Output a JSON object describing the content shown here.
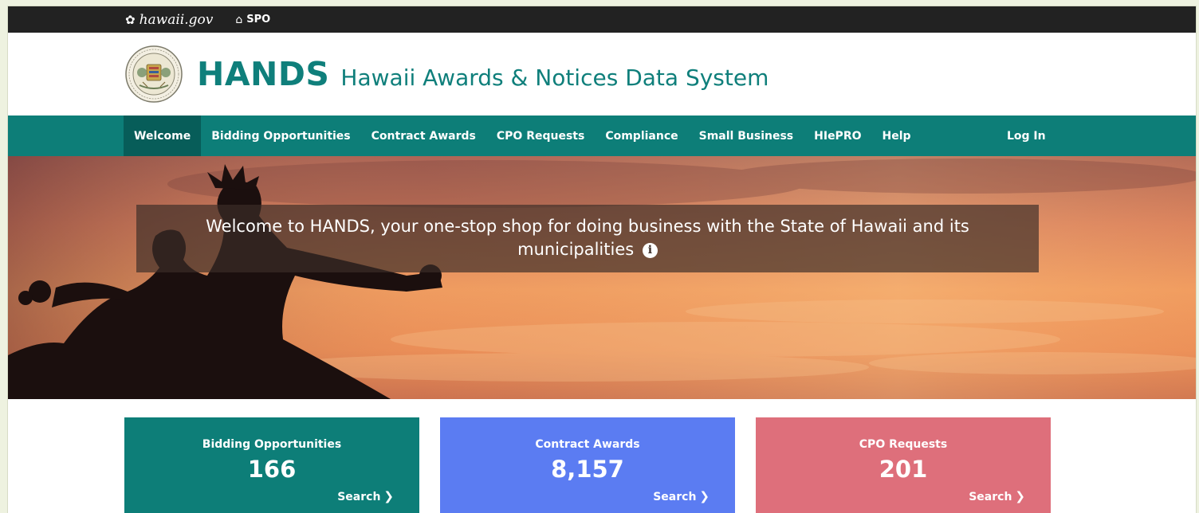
{
  "utility": {
    "gov_label": "hawaii.gov",
    "spo_label": "SPO"
  },
  "header": {
    "title": "HANDS",
    "subtitle": "Hawaii Awards & Notices Data System"
  },
  "nav": {
    "items": [
      {
        "label": "Welcome"
      },
      {
        "label": "Bidding Opportunities"
      },
      {
        "label": "Contract Awards"
      },
      {
        "label": "CPO Requests"
      },
      {
        "label": "Compliance"
      },
      {
        "label": "Small Business"
      },
      {
        "label": "HIePRO"
      },
      {
        "label": "Help"
      }
    ],
    "login": "Log In"
  },
  "hero": {
    "welcome_line1": "Welcome to HANDS, your one-stop shop for doing business with the State of Hawaii and its",
    "welcome_line2": "municipalities"
  },
  "cards": [
    {
      "title": "Bidding Opportunities",
      "count": "166",
      "action": "Search",
      "color": "#0d7e78"
    },
    {
      "title": "Contract Awards",
      "count": "8,157",
      "action": "Search",
      "color": "#5b7cf2"
    },
    {
      "title": "CPO Requests",
      "count": "201",
      "action": "Search",
      "color": "#de6f7b"
    }
  ],
  "colors": {
    "brand": "#0f7f7b",
    "nav": "#0d7e78",
    "nav_active": "#075d59",
    "topbar": "#222222"
  }
}
